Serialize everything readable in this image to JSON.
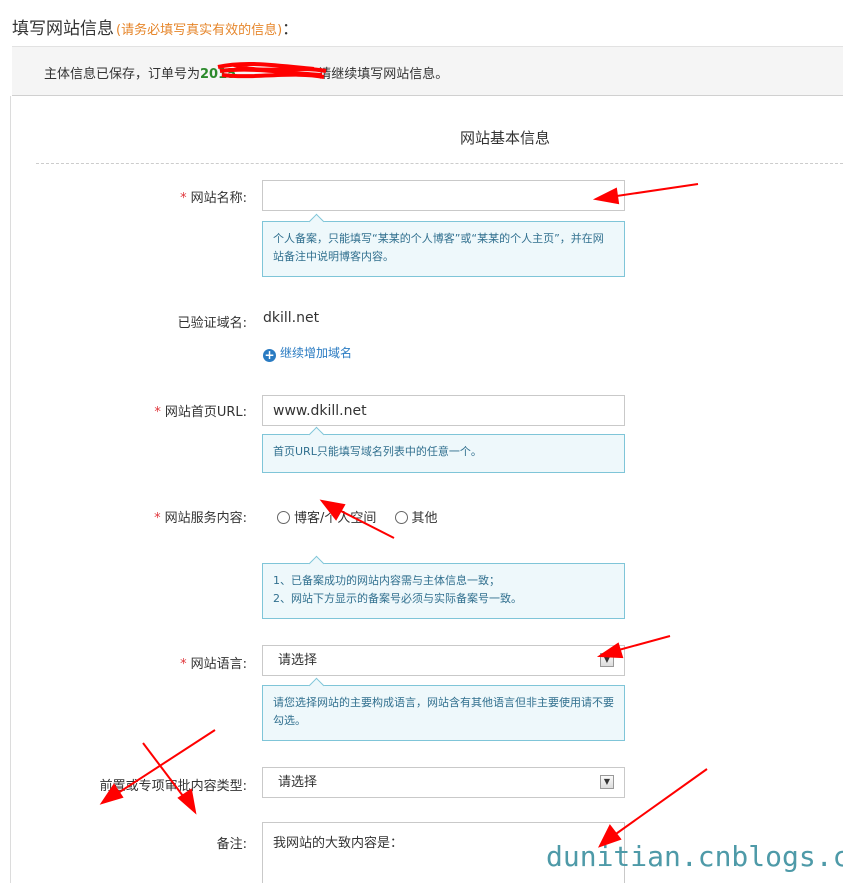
{
  "header": {
    "title": "填写网站信息",
    "hint": "(请务必填写真实有效的信息)",
    "colon": "："
  },
  "notice": {
    "prefix": "主体信息已保存，订单号为",
    "order_no": "2015",
    "suffix": "请继续填写网站信息。"
  },
  "section": {
    "title": "网站基本信息"
  },
  "form": {
    "site_name": {
      "required_mark": "*",
      "label": "网站名称:",
      "value": "",
      "tip": "个人备案，只能填写“某某的个人博客”或“某某的个人主页”，并在网站备注中说明博客内容。"
    },
    "verified_domain": {
      "label": "已验证域名:",
      "value": "dkill.net",
      "add_label": "继续增加域名"
    },
    "homepage_url": {
      "required_mark": "*",
      "label": "网站首页URL:",
      "value": "www.dkill.net",
      "tip": "首页URL只能填写域名列表中的任意一个。"
    },
    "service_content": {
      "required_mark": "*",
      "label": "网站服务内容:",
      "options": [
        "博客/个人空间",
        "其他"
      ],
      "tip_lines": [
        "1、已备案成功的网站内容需与主体信息一致；",
        "2、网站下方显示的备案号必须与实际备案号一致。"
      ]
    },
    "language": {
      "required_mark": "*",
      "label": "网站语言:",
      "selected": "请选择",
      "tip": "请您选择网站的主要构成语言，网站含有其他语言但非主要使用请不要勾选。"
    },
    "preapproval_type": {
      "label": "前置或专项审批内容类型:",
      "selected": "请选择"
    },
    "remark": {
      "label": "备注:",
      "value": "我网站的大致内容是："
    }
  },
  "watermark": "dunitian.cnblogs.com",
  "colors": {
    "accent_orange": "#e6862b",
    "required_red": "#e0353a",
    "tip_border": "#7fc5d8",
    "tip_bg": "#eef8fb",
    "link_blue": "#2a7bc2",
    "annotation_red": "#ff0000"
  }
}
